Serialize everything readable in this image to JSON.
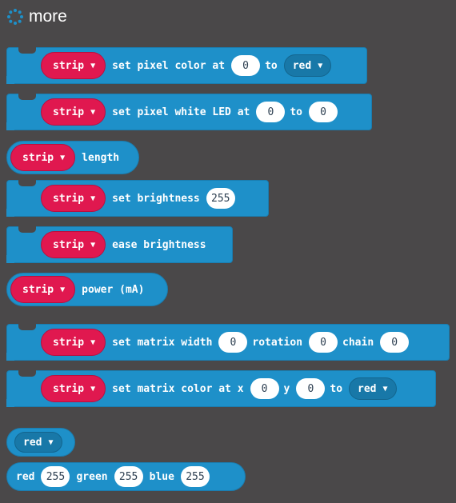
{
  "header": {
    "title": "more",
    "icon": "spinner-dots-icon"
  },
  "blocks": {
    "set_pixel_color": {
      "strip": "strip",
      "text1": "set pixel color at",
      "index": "0",
      "text2": "to",
      "color": "red"
    },
    "set_pixel_white": {
      "strip": "strip",
      "text1": "set pixel white LED at",
      "index": "0",
      "text2": "to",
      "value": "0"
    },
    "length": {
      "strip": "strip",
      "text": "length"
    },
    "set_brightness": {
      "strip": "strip",
      "text": "set brightness",
      "value": "255"
    },
    "ease_brightness": {
      "strip": "strip",
      "text": "ease brightness"
    },
    "power": {
      "strip": "strip",
      "text": "power (mA)"
    },
    "matrix_width": {
      "strip": "strip",
      "text1": "set matrix width",
      "width": "0",
      "text2": "rotation",
      "rotation": "0",
      "text3": "chain",
      "chain": "0"
    },
    "matrix_color": {
      "strip": "strip",
      "text1": "set matrix color at x",
      "x": "0",
      "text2": "y",
      "y": "0",
      "text3": "to",
      "color": "red"
    },
    "color_dropdown": {
      "color": "red"
    },
    "rgb": {
      "t1": "red",
      "r": "255",
      "t2": "green",
      "g": "255",
      "t3": "blue",
      "b": "255"
    }
  },
  "colors": {
    "background": "#4a4849",
    "block": "#1e90c9",
    "strip": "#e0184f"
  }
}
